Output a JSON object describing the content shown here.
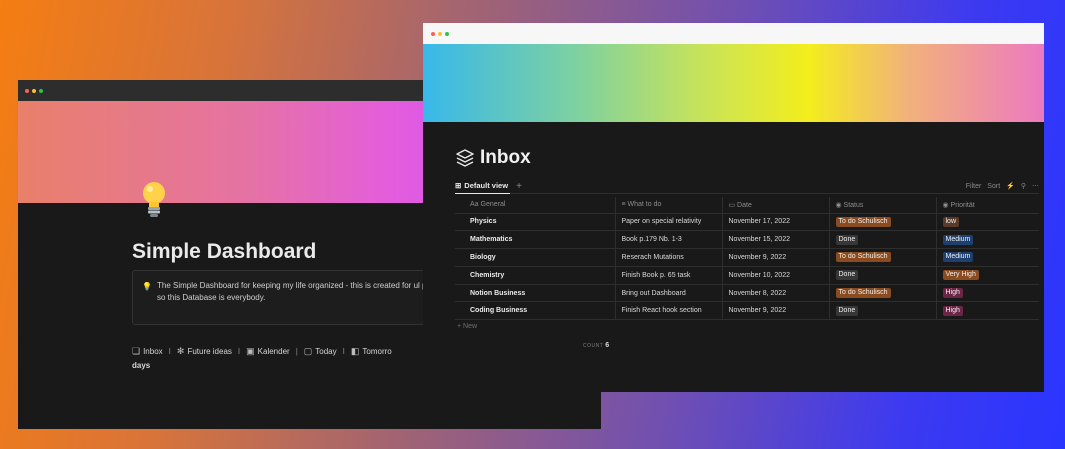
{
  "back_window": {
    "title": "Simple Dashboard",
    "icon": "lightbulb-icon",
    "callout": {
      "icon": "💡",
      "text": "The Simple Dashboard for keeping my life organized - this is created for ul productivity. Keeping everything organized is essential , so this Database is everybody."
    },
    "links": [
      {
        "icon": "stack-icon",
        "glyph": "❏",
        "label": "Inbox",
        "sep": "I"
      },
      {
        "icon": "palm-icon",
        "glyph": "✻",
        "label": "Future ideas",
        "sep": "I"
      },
      {
        "icon": "calendar-icon",
        "glyph": "▣",
        "label": "Kalender",
        "sep": "|"
      },
      {
        "icon": "page-icon",
        "glyph": "▢",
        "label": "Today",
        "sep": "I"
      },
      {
        "icon": "tomorrow-icon",
        "glyph": "◧",
        "label": "Tomorro",
        "sep": ""
      }
    ],
    "links_tail": "days"
  },
  "front_window": {
    "title": "Inbox",
    "icon": "stack-icon",
    "view": {
      "label": "Default view",
      "add": "+"
    },
    "toolbar": {
      "filter": "Filter",
      "sort": "Sort",
      "automation": "⚡",
      "search": "⚲",
      "more": "⋯"
    },
    "columns": {
      "general": "Aa General",
      "what_to_do": "≡ What to do",
      "date": "▭ Date",
      "status": "◉ Status",
      "priority": "◉ Priorität"
    },
    "rows": [
      {
        "general": "Physics",
        "what_to_do": "Paper on special relativity",
        "date": "November 17, 2022",
        "status": "To do Schulisch",
        "priority": "low"
      },
      {
        "general": "Mathematics",
        "what_to_do": "Book p.179 Nb. 1-3",
        "date": "November 15, 2022",
        "status": "Done",
        "priority": "Medium"
      },
      {
        "general": "Biology",
        "what_to_do": "Reserach Mutations",
        "date": "November 9, 2022",
        "status": "To do Schulisch",
        "priority": "Medium"
      },
      {
        "general": "Chemistry",
        "what_to_do": "Finish Book p. 65 task",
        "date": "November 10, 2022",
        "status": "Done",
        "priority": "Very High"
      },
      {
        "general": "Notion Business",
        "what_to_do": "Bring out Dashboard",
        "date": "November 8, 2022",
        "status": "To do Schulisch",
        "priority": "High"
      },
      {
        "general": "Coding Business",
        "what_to_do": "Finish React hook section",
        "date": "November 9, 2022",
        "status": "Done",
        "priority": "High"
      }
    ],
    "new_label": "+ New",
    "count_label": "COUNT",
    "count_value": "6",
    "tag_colors": {
      "To do Schulisch": "#8a4b1f",
      "Done": "#373737",
      "low": "#5a3a28",
      "Medium": "#1f3f6e",
      "Very High": "#8a4b1f",
      "High": "#6d2546"
    }
  }
}
